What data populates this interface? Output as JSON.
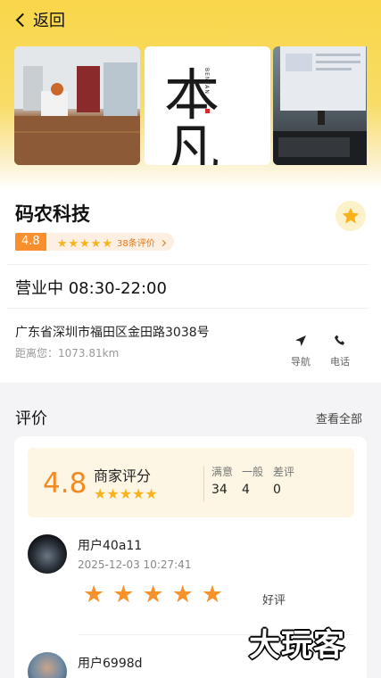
{
  "header": {
    "back_label": "返回"
  },
  "gallery": {
    "logo_text": "本凡",
    "logo_side_text": "BENFAN"
  },
  "shop": {
    "name": "码农科技",
    "rating": "4.8",
    "review_count_label": "38条评价",
    "hours": "营业中 08:30-22:00",
    "address": "广东省深圳市福田区金田路3038号",
    "distance": "距离您：1073.81km",
    "nav_label": "导航",
    "phone_label": "电话"
  },
  "reviews": {
    "title": "评价",
    "view_all": "查看全部",
    "summary": {
      "score": "4.8",
      "label": "商家评分",
      "stats": [
        {
          "label": "满意",
          "value": "34"
        },
        {
          "label": "一般",
          "value": "4"
        },
        {
          "label": "差评",
          "value": "0"
        }
      ]
    },
    "items": [
      {
        "user": "用户40a11",
        "time": "2025-12-03 10:27:41",
        "stars": 5,
        "tag": "好评"
      },
      {
        "user": "用户6998d"
      }
    ]
  },
  "watermark": "大玩客",
  "colors": {
    "accent": "#f7902c",
    "star": "#f8b21c",
    "header_yellow": "#f9d649"
  }
}
